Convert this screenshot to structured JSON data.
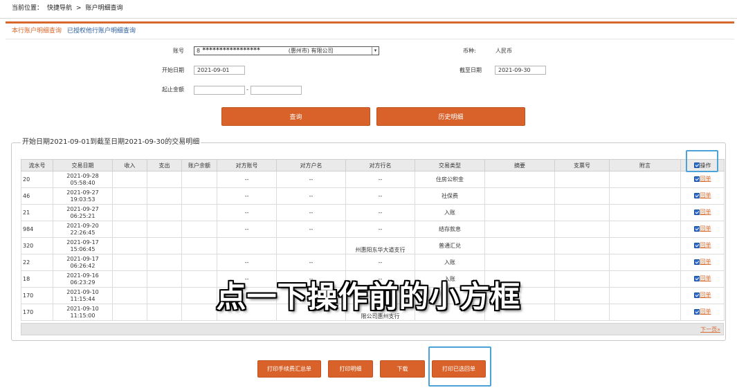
{
  "breadcrumb": {
    "prefix": "当前位置：",
    "level1": "快捷导航",
    "separator": ">",
    "level2": "账户明细查询"
  },
  "tabs": {
    "active": "本行账户明细查询",
    "other": "已授权他行账户明细查询"
  },
  "form": {
    "account_label": "账号",
    "account_prefix": "8",
    "account_masked": "*****************",
    "account_suffix": "(惠州市) 有限公司",
    "currency_label": "币种:",
    "currency_value": "人民币",
    "start_label": "开始日期",
    "start_value": "2021-09-01",
    "end_label": "截至日期",
    "end_value": "2021-09-30",
    "amount_label": "起止金额",
    "amount_separator": "-",
    "amount_from": "",
    "amount_to": ""
  },
  "buttons": {
    "query": "查询",
    "history": "历史明细"
  },
  "legend": "开始日期2021-09-01到截至日期2021-09-30的交易明细",
  "table": {
    "headers": [
      "流水号",
      "交易日期",
      "收入",
      "支出",
      "账户余额",
      "对方账号",
      "对方户名",
      "对方行名",
      "交易类型",
      "摘要",
      "支票号",
      "附言",
      "操作"
    ],
    "receipt_label": "回单",
    "rows": [
      {
        "serial": "20",
        "date": "2021-09-28",
        "time": "05:58:40",
        "account": "--",
        "name": "--",
        "bank": "--",
        "type": "住房公积金",
        "memo": ""
      },
      {
        "serial": "46",
        "date": "2021-09-27",
        "time": "19:03:53",
        "account": "--",
        "name": "--",
        "bank": "--",
        "type": "社保费",
        "memo": ""
      },
      {
        "serial": "21",
        "date": "2021-09-27",
        "time": "06:25:21",
        "account": "--",
        "name": "--",
        "bank": "--",
        "type": "入账",
        "memo": ""
      },
      {
        "serial": "984",
        "date": "2021-09-20",
        "time": "22:26:45",
        "account": "--",
        "name": "--",
        "bank": "--",
        "type": "结存款息",
        "memo": ""
      },
      {
        "serial": "320",
        "date": "2021-09-17",
        "time": "15:06:45",
        "account": "",
        "name": "",
        "bank": "州惠阳东华大道支行",
        "type": "普通汇兑",
        "memo": ""
      },
      {
        "serial": "22",
        "date": "2021-09-17",
        "time": "06:26:42",
        "account": "--",
        "name": "--",
        "bank": "--",
        "type": "入账",
        "memo": ""
      },
      {
        "serial": "18",
        "date": "2021-09-16",
        "time": "06:23:29",
        "account": "--",
        "name": "--",
        "bank": "--",
        "type": "入账",
        "memo": ""
      },
      {
        "serial": "170",
        "date": "2021-09-10",
        "time": "11:15:44",
        "account": "",
        "name": "",
        "bank": "",
        "type": "",
        "memo": ""
      },
      {
        "serial": "170",
        "date": "2021-09-10",
        "time": "11:15:00",
        "account": "",
        "name": "",
        "bank": "限公司惠州支行",
        "type": "",
        "memo": ""
      }
    ],
    "next_page": "下一页»"
  },
  "bottom_buttons": {
    "fee_summary": "打印手续费汇总单",
    "print_detail": "打印明细",
    "download": "下载",
    "print_selected": "打印已选回单"
  },
  "subtitle": "点一下操作前的小方框",
  "colors": {
    "accent": "#d7672a",
    "highlight": "#4aa3d8",
    "checkbox": "#2e6fd1"
  }
}
